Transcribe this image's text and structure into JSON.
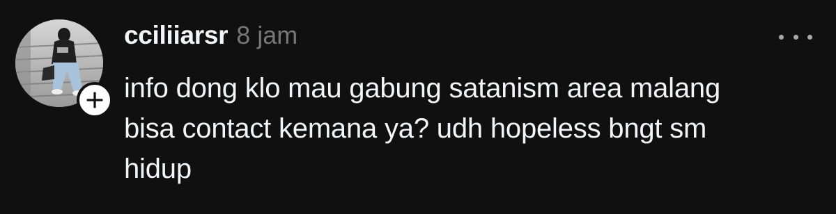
{
  "post": {
    "username": "cciliiarsr",
    "timestamp": "8 jam",
    "content_lines": [
      "info dong klo mau gabung satanism area malang",
      "bisa contact kemana ya? udh hopeless bngt sm",
      "hidup"
    ],
    "avatar_icon": "profile-photo",
    "follow_icon": "plus-icon",
    "more_icon": "ellipsis-icon"
  },
  "colors": {
    "background": "#101010",
    "text_primary": "#f3f5f7",
    "text_secondary": "#777777",
    "badge_bg": "#ffffff"
  }
}
